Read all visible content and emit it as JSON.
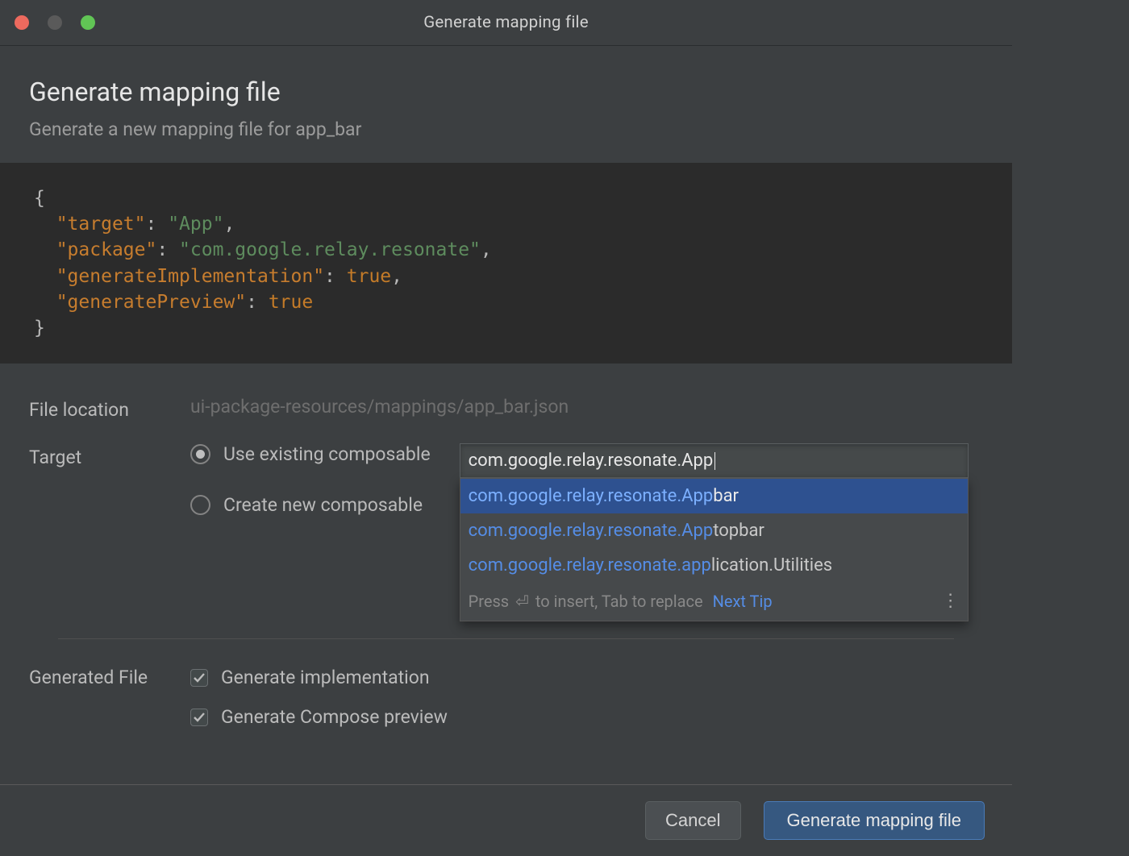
{
  "window": {
    "title": "Generate mapping file"
  },
  "header": {
    "title": "Generate mapping file",
    "subtitle": "Generate a new mapping file for app_bar"
  },
  "code": {
    "lines": [
      {
        "type": "punct",
        "text": "{"
      },
      {
        "type": "kv",
        "key": "\"target\"",
        "value": "\"App\"",
        "tail": ","
      },
      {
        "type": "kv",
        "key": "\"package\"",
        "value": "\"com.google.relay.resonate\"",
        "tail": ","
      },
      {
        "type": "kw",
        "key": "\"generateImplementation\"",
        "value": "true",
        "tail": ","
      },
      {
        "type": "kw",
        "key": "\"generatePreview\"",
        "value": "true",
        "tail": ""
      },
      {
        "type": "punct",
        "text": "}"
      }
    ]
  },
  "form": {
    "file_location_label": "File location",
    "file_location_value": "ui-package-resources/mappings/app_bar.json",
    "target_label": "Target",
    "radio_existing": "Use existing composable",
    "radio_new": "Create new composable",
    "target_input": "com.google.relay.resonate.App",
    "suggestions": [
      {
        "prefix": "com.google.relay.resonate.App",
        "rest": "bar",
        "selected": true
      },
      {
        "prefix": "com.google.relay.resonate.App",
        "rest": "topbar",
        "selected": false
      },
      {
        "prefix": "com.google.relay.resonate.app",
        "rest": "lication.Utilities",
        "selected": false
      }
    ],
    "suggestion_hint_1": "Press ",
    "suggestion_hint_2": " to insert, Tab to replace",
    "next_tip": "Next Tip",
    "gen_file_label": "Generated File",
    "chk_impl": "Generate implementation",
    "chk_preview": "Generate Compose preview"
  },
  "buttons": {
    "cancel": "Cancel",
    "primary": "Generate mapping file"
  }
}
